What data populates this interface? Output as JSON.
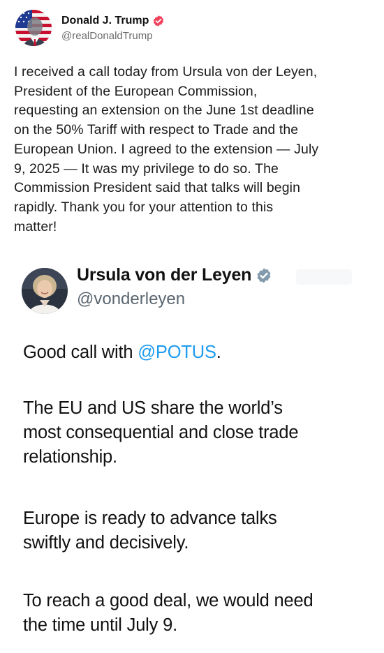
{
  "post": {
    "author_name": "Donald J. Trump",
    "author_handle": "@realDonaldTrump",
    "verified_color": "#f0425d",
    "text": "I received a call today from Ursula von der Leyen,\nPresident of the European Commission,\nrequesting an extension on the June 1st deadline\non the 50% Tariff with respect to Trade and the\nEuropean Union. I agreed to the extension — July\n9, 2025 — It was my privilege to do so. The\nCommission President said that talks will begin\nrapidly. Thank you for your attention to this\nmatter!"
  },
  "embedded_tweet": {
    "author_name": "Ursula von der Leyen",
    "author_handle": "@vonderleyen",
    "verified_color": "#829aab",
    "mention_color": "#1d9bf0",
    "paragraph_1_prefix": "Good call with ",
    "paragraph_1_mention": "@POTUS",
    "paragraph_1_suffix": ".",
    "paragraph_2": "The EU and US share the world’s\nmost consequential and close trade\nrelationship.",
    "paragraph_3": "Europe is ready to advance talks\nswiftly and decisively.",
    "paragraph_4": "To reach a good deal, we would need\nthe time until July 9."
  }
}
